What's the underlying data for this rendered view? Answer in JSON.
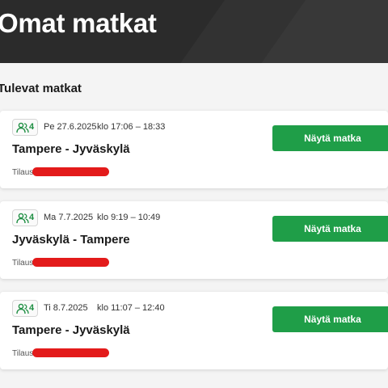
{
  "header": {
    "title": "Omat matkat"
  },
  "section": {
    "title": "Tulevat matkat"
  },
  "colors": {
    "accent": "#1f9e48",
    "header_bg": "#2b2b2b",
    "redaction": "#e31b1b"
  },
  "trips": [
    {
      "passengers": "4",
      "date": "Pe 27.6.2025",
      "time": "klo 17:06 – 18:33",
      "route": "Tampere - Jyväskylä",
      "order_label": "Tilaus:",
      "button_label": "Näytä matka"
    },
    {
      "passengers": "4",
      "date": "Ma 7.7.2025",
      "time": "klo 9:19 – 10:49",
      "route": "Jyväskylä - Tampere",
      "order_label": "Tilaus:",
      "button_label": "Näytä matka"
    },
    {
      "passengers": "4",
      "date": "Ti 8.7.2025",
      "time": "klo 11:07 – 12:40",
      "route": "Tampere - Jyväskylä",
      "order_label": "Tilaus:",
      "button_label": "Näytä matka"
    }
  ]
}
